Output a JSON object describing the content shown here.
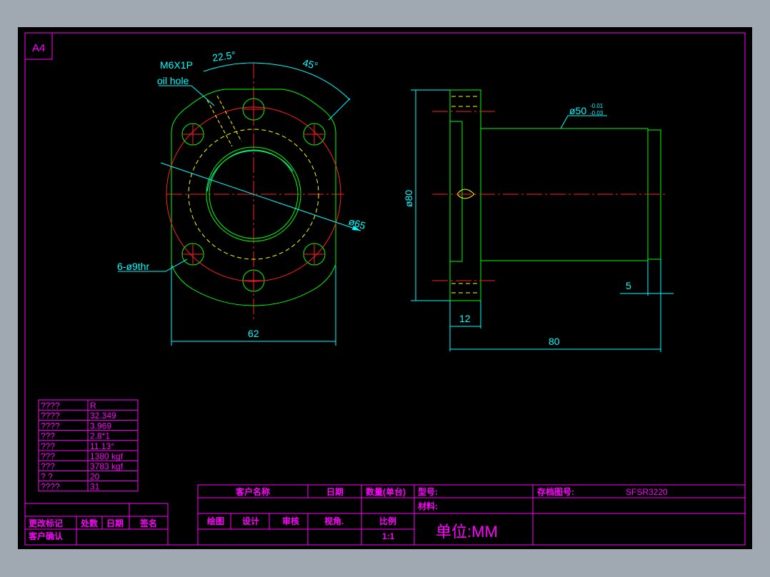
{
  "sheet": {
    "size_label": "A4"
  },
  "front_view": {
    "thread_label": "M6X1P",
    "oil_hole_label": "oil hole",
    "angle_small": "22.5°",
    "angle_large": "45°",
    "pcd_label": "ø65",
    "holes_label": "6-ø9thr",
    "width_label": "62"
  },
  "side_view": {
    "shaft_dia_label": "ø50",
    "tol_upper": "-0.01",
    "tol_lower": "-0.03",
    "flange_dia_label": "ø80",
    "step_label": "5",
    "flange_thk_label": "12",
    "length_label": "80"
  },
  "spec_table": {
    "rows": [
      {
        "k": "????",
        "v": "R"
      },
      {
        "k": "????",
        "v": "32.349"
      },
      {
        "k": "????",
        "v": "3.969"
      },
      {
        "k": " ???",
        "v": "2.8*1"
      },
      {
        "k": " ???",
        "v": "11.13°"
      },
      {
        "k": " ???",
        "v": "1380 kgf"
      },
      {
        "k": " ???",
        "v": "3783 kgf"
      },
      {
        "k": " ?  ?",
        "v": "20"
      },
      {
        "k": "????",
        "v": "31"
      }
    ]
  },
  "revision_block": {
    "change_mark": "更改标记",
    "count": "处数",
    "date": "日期",
    "sign": "签名",
    "customer_confirm": "客户确认"
  },
  "title_block": {
    "customer_name": "客户名称",
    "date": "日期",
    "qty": "数量(单台)",
    "model": "型号:",
    "archive_no": "存档图号:",
    "part_no": "SFSR3220",
    "material": "材料:",
    "drawn": "绘图",
    "design": "设计",
    "review": "审核",
    "view_angle": "视角.",
    "scale_label": "比例",
    "scale_value": "1:1",
    "unit": "单位:MM"
  }
}
